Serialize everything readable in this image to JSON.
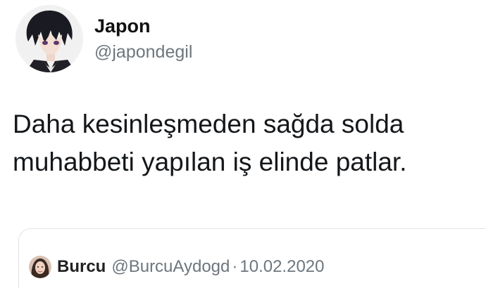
{
  "tweet": {
    "author": {
      "display_name": "Japon",
      "handle": "@japondegil",
      "avatar": "anime-avatar-icon"
    },
    "text_line1": "Daha kesinleşmeden sağda solda",
    "text_line2": "muhabbeti yapılan iş elinde patlar."
  },
  "quoted": {
    "display_name": "Burcu",
    "handle": "@BurcuAydogd",
    "separator": "·",
    "date": "10.02.2020",
    "avatar": "user-avatar-icon"
  }
}
